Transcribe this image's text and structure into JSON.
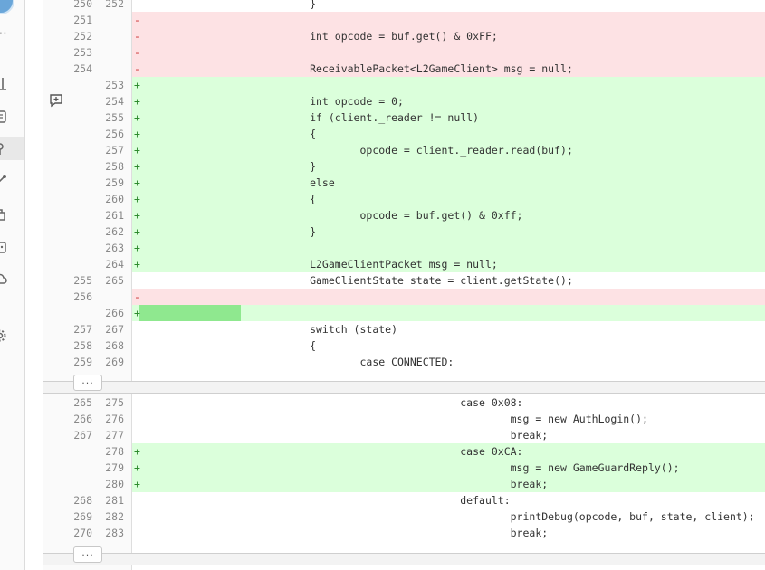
{
  "sidebar": {
    "icons": [
      {
        "name": "more-icon",
        "glyph": "⋯"
      },
      {
        "name": "chart-icon"
      },
      {
        "name": "document-icon"
      },
      {
        "name": "git-icon"
      },
      {
        "name": "pipeline-icon"
      },
      {
        "name": "package-icon"
      },
      {
        "name": "box-icon"
      },
      {
        "name": "cloud-icon"
      },
      {
        "name": "gear-icon"
      }
    ]
  },
  "diff": {
    "expand_label": "...",
    "hunk1": [
      {
        "old": "250",
        "new": "252",
        "sign": "",
        "type": "ctx",
        "code": "            }"
      },
      {
        "old": "251",
        "new": "",
        "sign": "-",
        "type": "del",
        "code": ""
      },
      {
        "old": "252",
        "new": "",
        "sign": "-",
        "type": "del",
        "code": "            int opcode = buf.get() & 0xFF;"
      },
      {
        "old": "253",
        "new": "",
        "sign": "-",
        "type": "del",
        "code": ""
      },
      {
        "old": "254",
        "new": "",
        "sign": "-",
        "type": "del",
        "code": "            ReceivablePacket<L2GameClient> msg = null;"
      },
      {
        "old": "",
        "new": "253",
        "sign": "+",
        "type": "add",
        "code": ""
      },
      {
        "old": "",
        "new": "254",
        "sign": "+",
        "type": "add",
        "code": "            int opcode = 0;"
      },
      {
        "old": "",
        "new": "255",
        "sign": "+",
        "type": "add",
        "code": "            if (client._reader != null)"
      },
      {
        "old": "",
        "new": "256",
        "sign": "+",
        "type": "add",
        "code": "            {"
      },
      {
        "old": "",
        "new": "257",
        "sign": "+",
        "type": "add",
        "code": "                    opcode = client._reader.read(buf);"
      },
      {
        "old": "",
        "new": "258",
        "sign": "+",
        "type": "add",
        "code": "            }"
      },
      {
        "old": "",
        "new": "259",
        "sign": "+",
        "type": "add",
        "code": "            else"
      },
      {
        "old": "",
        "new": "260",
        "sign": "+",
        "type": "add",
        "code": "            {"
      },
      {
        "old": "",
        "new": "261",
        "sign": "+",
        "type": "add",
        "code": "                    opcode = buf.get() & 0xff;"
      },
      {
        "old": "",
        "new": "262",
        "sign": "+",
        "type": "add",
        "code": "            }"
      },
      {
        "old": "",
        "new": "263",
        "sign": "+",
        "type": "add",
        "code": ""
      },
      {
        "old": "",
        "new": "264",
        "sign": "+",
        "type": "add",
        "code": "            L2GameClientPacket msg = null;"
      },
      {
        "old": "255",
        "new": "265",
        "sign": "",
        "type": "ctx",
        "code": "            GameClientState state = client.getState();"
      },
      {
        "old": "256",
        "new": "",
        "sign": "-",
        "type": "del",
        "code": ""
      },
      {
        "old": "",
        "new": "266",
        "sign": "+",
        "type": "add",
        "code": "",
        "highlight": true
      },
      {
        "old": "257",
        "new": "267",
        "sign": "",
        "type": "ctx",
        "code": "            switch (state)"
      },
      {
        "old": "258",
        "new": "268",
        "sign": "",
        "type": "ctx",
        "code": "            {"
      },
      {
        "old": "259",
        "new": "269",
        "sign": "",
        "type": "ctx",
        "code": "                    case CONNECTED:"
      }
    ],
    "hunk2": [
      {
        "old": "265",
        "new": "275",
        "sign": "",
        "type": "ctx",
        "code": "                                    case 0x08:"
      },
      {
        "old": "266",
        "new": "276",
        "sign": "",
        "type": "ctx",
        "code": "                                            msg = new AuthLogin();"
      },
      {
        "old": "267",
        "new": "277",
        "sign": "",
        "type": "ctx",
        "code": "                                            break;"
      },
      {
        "old": "",
        "new": "278",
        "sign": "+",
        "type": "add",
        "code": "                                    case 0xCA:"
      },
      {
        "old": "",
        "new": "279",
        "sign": "+",
        "type": "add",
        "code": "                                            msg = new GameGuardReply();"
      },
      {
        "old": "",
        "new": "280",
        "sign": "+",
        "type": "add",
        "code": "                                            break;"
      },
      {
        "old": "268",
        "new": "281",
        "sign": "",
        "type": "ctx",
        "code": "                                    default:"
      },
      {
        "old": "269",
        "new": "282",
        "sign": "",
        "type": "ctx",
        "code": "                                            printDebug(opcode, buf, state, client);"
      },
      {
        "old": "270",
        "new": "283",
        "sign": "",
        "type": "ctx",
        "code": "                                            break;"
      }
    ]
  }
}
